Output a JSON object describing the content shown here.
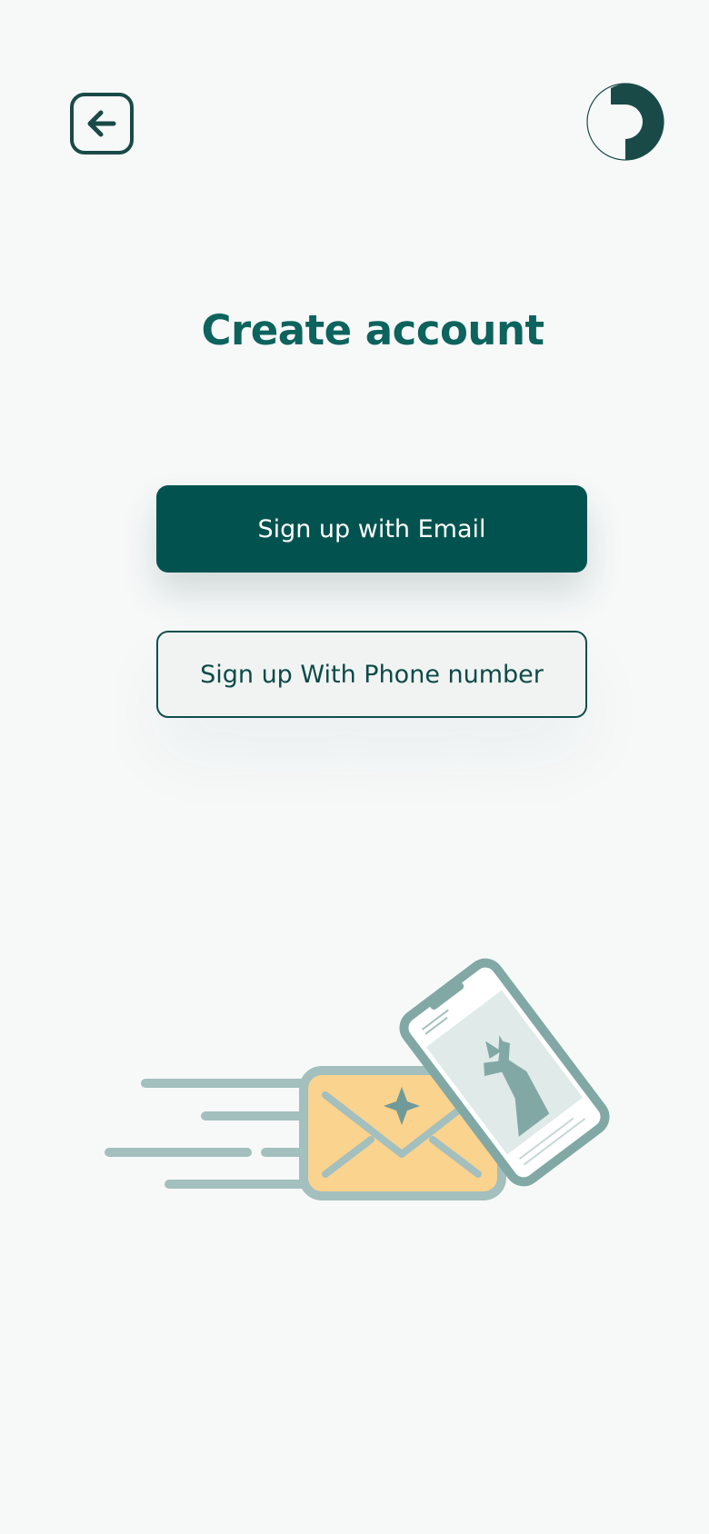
{
  "header": {
    "back_icon": "arrow-left-icon",
    "logo_icon": "brand-logo-icon"
  },
  "main": {
    "title": "Create account",
    "email_button_label": "Sign up with Email",
    "phone_button_label": "Sign up With Phone number"
  },
  "illustration": {
    "name": "flying-envelope-and-phone-illustration",
    "colors": {
      "envelope": "#fad38f",
      "outline": "#a3bfbe",
      "phone": "#82a8a5"
    }
  },
  "colors": {
    "background": "#f7f9f9",
    "primary": "#02534f",
    "title": "#0d635d",
    "icon": "#1a4a47"
  }
}
